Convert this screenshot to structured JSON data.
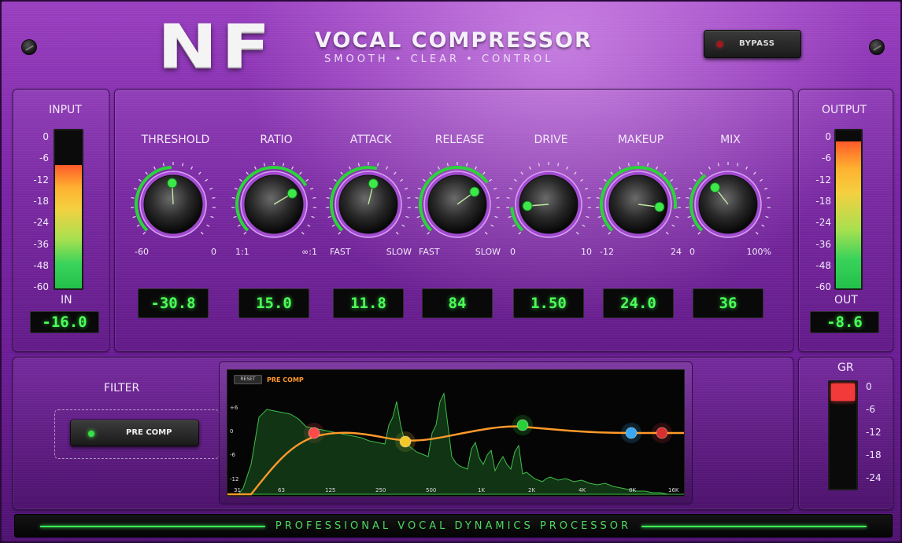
{
  "header": {
    "logo": "NF",
    "title": "VOCAL COMPRESSOR",
    "subtitle": "SMOOTH • CLEAR • CONTROL",
    "bypass_label": "BYPASS"
  },
  "input_meter": {
    "title": "INPUT",
    "scale": [
      "0",
      "-6",
      "-12",
      "-18",
      "-24",
      "-36",
      "-48",
      "-60"
    ],
    "label": "IN",
    "value": "-16.0",
    "level": 0.78
  },
  "output_meter": {
    "title": "OUTPUT",
    "scale": [
      "0",
      "-6",
      "-12",
      "-18",
      "-24",
      "-36",
      "-48",
      "-60"
    ],
    "label": "OUT",
    "value": "-8.6",
    "level": 0.93
  },
  "knobs": [
    {
      "label": "THRESHOLD",
      "min": "-60",
      "max": "0",
      "value": "-30.8",
      "pos": 0.49
    },
    {
      "label": "RATIO",
      "min": "1:1",
      "max": "∞:1",
      "value": "15.0",
      "pos": 0.72
    },
    {
      "label": "ATTACK",
      "min": "FAST",
      "max": "SLOW",
      "value": "11.8",
      "pos": 0.55
    },
    {
      "label": "RELEASE",
      "min": "FAST",
      "max": "SLOW",
      "value": "84",
      "pos": 0.7
    },
    {
      "label": "DRIVE",
      "min": "0",
      "max": "10",
      "value": "1.50",
      "pos": 0.15
    },
    {
      "label": "MAKEUP",
      "min": "-12",
      "max": "24",
      "value": "24.0",
      "pos": 0.86
    },
    {
      "label": "MIX",
      "min": "0",
      "max": "100%",
      "value": "36",
      "pos": 0.36
    }
  ],
  "filter": {
    "title": "FILTER",
    "precomp_label": "PRE COMP",
    "reset_label": "RESET",
    "eq_tag": "PRE COMP",
    "db_labels": [
      "+6",
      "0",
      "-6",
      "-12"
    ],
    "freq_labels": [
      "31",
      "63",
      "125",
      "250",
      "500",
      "1K",
      "2K",
      "4K",
      "8K",
      "16K"
    ],
    "nodes_color": [
      "#ff4a4a",
      "#f5c82a",
      "#2ad03a",
      "#3aa8f0",
      "#d83030"
    ]
  },
  "gr_meter": {
    "title": "GR",
    "scale": [
      "0",
      "-6",
      "-12",
      "-18",
      "-24"
    ],
    "level": 0.16
  },
  "footer": {
    "text": "PROFESSIONAL VOCAL DYNAMICS PROCESSOR"
  },
  "colors": {
    "accent_green": "#3cff5a",
    "panel_purple": "#7a23a6"
  }
}
